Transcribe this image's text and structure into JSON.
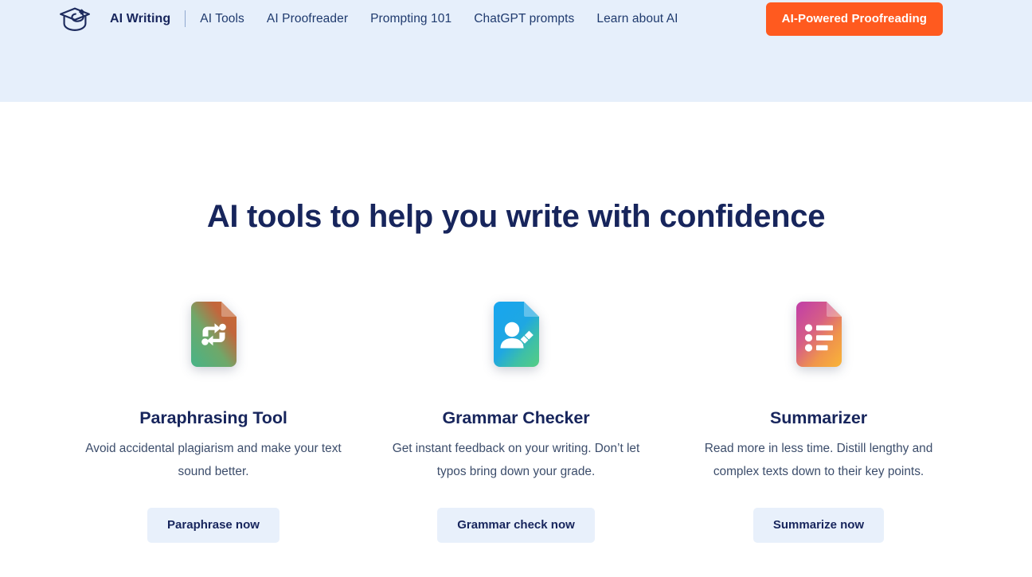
{
  "header": {
    "background_color": "#E6EFFB",
    "logo_icon": "graduation-cap-icon",
    "nav": [
      {
        "label": "AI Writing",
        "active": true
      },
      {
        "label": "AI Tools",
        "active": false
      },
      {
        "label": "AI Proofreader",
        "active": false
      },
      {
        "label": "Prompting 101",
        "active": false
      },
      {
        "label": "ChatGPT prompts",
        "active": false
      },
      {
        "label": "Learn about AI",
        "active": false
      }
    ],
    "cta": {
      "label": "AI-Powered Proofreading",
      "background_color": "#FF5A1F",
      "text_color": "#FFFFFF"
    }
  },
  "main": {
    "title": "AI tools to help you write with confidence",
    "title_color": "#17255C",
    "cards": [
      {
        "icon": "paraphrase-document-icon",
        "icon_gradient": [
          "#3FA878",
          "#C8653A"
        ],
        "title": "Paraphrasing Tool",
        "description": "Avoid accidental plagiarism and make your text sound better.",
        "button_label": "Paraphrase now"
      },
      {
        "icon": "grammar-person-pencil-document-icon",
        "icon_gradient": [
          "#1FA8E8",
          "#4CC98E"
        ],
        "title": "Grammar Checker",
        "description": "Get instant feedback on your writing. Don’t let typos bring down your grade.",
        "button_label": "Grammar check now"
      },
      {
        "icon": "summarizer-list-document-icon",
        "icon_gradient": [
          "#B93FA8",
          "#F6A83C"
        ],
        "title": "Summarizer",
        "description": "Read more in less time. Distill lengthy and complex texts down to their key points.",
        "button_label": "Summarize now"
      }
    ],
    "button_background_color": "#E8F0FB",
    "button_text_color": "#17255C"
  }
}
